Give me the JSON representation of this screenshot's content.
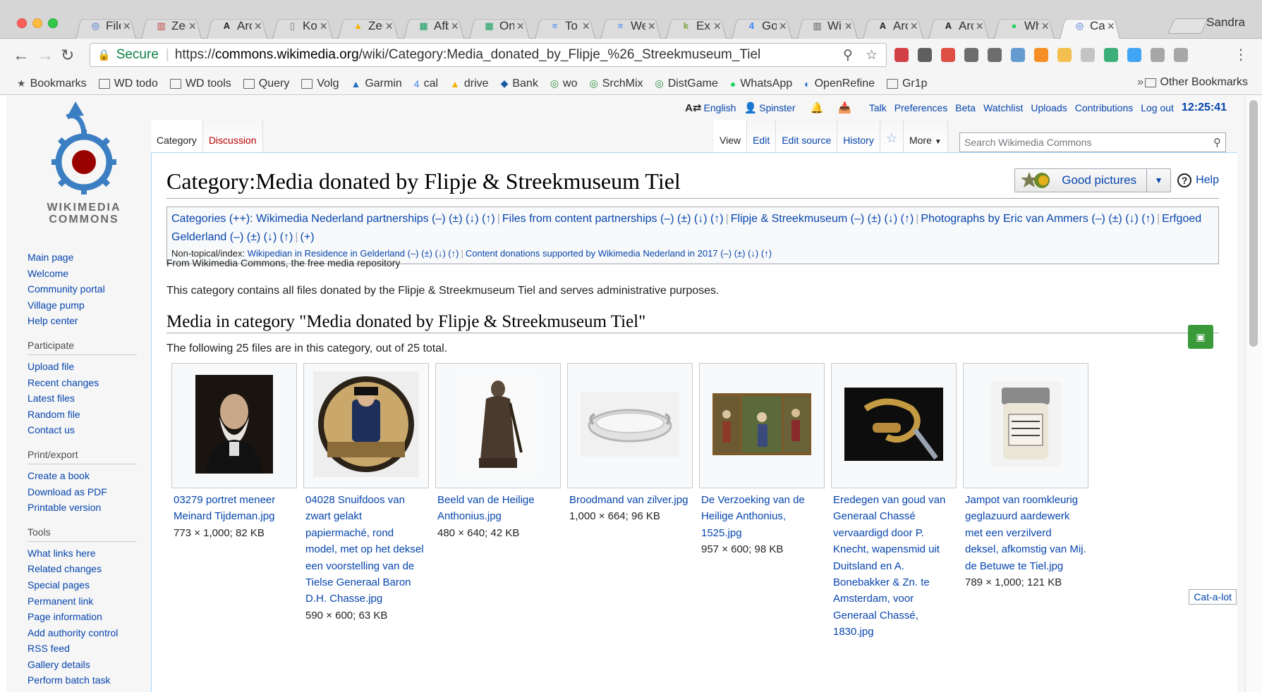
{
  "browser": {
    "profile_name": "Sandra",
    "tabs": [
      {
        "label": "File",
        "icon": "wikimedia-icon",
        "color": "#3366cc"
      },
      {
        "label": "Zee",
        "icon": "barcode-icon",
        "color": "#c43c3c"
      },
      {
        "label": "Arc",
        "icon": "archiefbank-icon",
        "color": "#1c1c1c"
      },
      {
        "label": "Kor",
        "icon": "page-icon",
        "color": "#777777"
      },
      {
        "label": "Zee",
        "icon": "drive-icon",
        "color": "#f4b400"
      },
      {
        "label": "Afb",
        "icon": "sheets-icon",
        "color": "#0f9d58"
      },
      {
        "label": "Onc",
        "icon": "sheets-icon",
        "color": "#0f9d58"
      },
      {
        "label": "To",
        "icon": "docs-icon",
        "color": "#4285f4"
      },
      {
        "label": "We",
        "icon": "docs-icon",
        "color": "#4285f4"
      },
      {
        "label": "Exp",
        "icon": "kaggle-icon",
        "color": "#7aa33c"
      },
      {
        "label": "Goo",
        "icon": "calendar-icon",
        "color": "#4285f4"
      },
      {
        "label": "Wik",
        "icon": "barcode-icon",
        "color": "#555555"
      },
      {
        "label": "Arc",
        "icon": "archiefbank-icon",
        "color": "#1c1c1c"
      },
      {
        "label": "Arc",
        "icon": "archiefbank-icon",
        "color": "#1c1c1c"
      },
      {
        "label": "Wh",
        "icon": "whatsapp-icon",
        "color": "#25d366"
      },
      {
        "label": "Cat",
        "icon": "wikimedia-icon",
        "color": "#3366cc",
        "active": true
      }
    ],
    "url_secure_label": "Secure",
    "url_scheme": "https://",
    "url_domain": "commons.wikimedia.org",
    "url_path": "/wiki/Category:Media_donated_by_Flipje_%26_Streekmuseum_Tiel",
    "extensions": [
      {
        "icon": "pinterest-icon",
        "color": "#cb2027"
      },
      {
        "icon": "evernote-icon",
        "color": "#444444"
      },
      {
        "icon": "calendar-badge-icon",
        "color": "#d93025"
      },
      {
        "icon": "reader-icon",
        "color": "#555555"
      },
      {
        "icon": "globe-icon",
        "color": "#555555"
      },
      {
        "icon": "screenshot-icon",
        "color": "#4a8cca"
      },
      {
        "icon": "chart-icon",
        "color": "#f57c00"
      },
      {
        "icon": "folder-icon",
        "color": "#f2b632"
      },
      {
        "icon": "cloud-icon",
        "color": "#bbbbbb"
      },
      {
        "icon": "leaf-icon",
        "color": "#1aa260"
      },
      {
        "icon": "download-icon",
        "color": "#2196f3"
      },
      {
        "icon": "tab-icon",
        "color": "#999999"
      },
      {
        "icon": "window-icon",
        "color": "#999999"
      }
    ],
    "bookmarks": [
      {
        "label": "Bookmarks",
        "icon": "star-icon"
      },
      {
        "label": "WD todo",
        "icon": "folder-icon"
      },
      {
        "label": "WD tools",
        "icon": "folder-icon"
      },
      {
        "label": "Query",
        "icon": "folder-icon"
      },
      {
        "label": "Volg",
        "icon": "folder-icon"
      },
      {
        "label": "Garmin",
        "icon": "garmin-icon"
      },
      {
        "label": "cal",
        "icon": "calendar-icon"
      },
      {
        "label": "drive",
        "icon": "drive-icon"
      },
      {
        "label": "Bank",
        "icon": "bank-icon"
      },
      {
        "label": "wo",
        "icon": "wikidata-icon"
      },
      {
        "label": "SrchMix",
        "icon": "wikidata-icon"
      },
      {
        "label": "DistGame",
        "icon": "wikidata-icon"
      },
      {
        "label": "WhatsApp",
        "icon": "whatsapp-icon"
      },
      {
        "label": "OpenRefine",
        "icon": "openrefine-icon"
      },
      {
        "label": "Gr1p",
        "icon": "folder-icon"
      }
    ],
    "bookmarks_overflow": "»",
    "other_bookmarks": "Other Bookmarks"
  },
  "wiki": {
    "logo_line1": "WIKIMEDIA",
    "logo_line2": "COMMONS",
    "personal": {
      "language": "English",
      "username": "Spinster",
      "links": [
        "Talk",
        "Preferences",
        "Beta",
        "Watchlist",
        "Uploads",
        "Contributions",
        "Log out"
      ],
      "clock": "12:25:41"
    },
    "nav_tabs_left": [
      {
        "label": "Category",
        "selected": true
      },
      {
        "label": "Discussion",
        "selected": false
      }
    ],
    "nav_tabs_right": [
      {
        "label": "View",
        "selected": true
      },
      {
        "label": "Edit"
      },
      {
        "label": "Edit source"
      },
      {
        "label": "History"
      },
      {
        "label": "☆"
      },
      {
        "label": "More"
      }
    ],
    "search_placeholder": "Search Wikimedia Commons",
    "sidebar": {
      "main": [
        "Main page",
        "Welcome",
        "Community portal",
        "Village pump",
        "Help center"
      ],
      "participate_heading": "Participate",
      "participate": [
        "Upload file",
        "Recent changes",
        "Latest files",
        "Random file",
        "Contact us"
      ],
      "print_heading": "Print/export",
      "print": [
        "Create a book",
        "Download as PDF",
        "Printable version"
      ],
      "tools_heading": "Tools",
      "tools": [
        "What links here",
        "Related changes",
        "Special pages",
        "Permanent link",
        "Page information",
        "Add authority control",
        "RSS feed",
        "Gallery details",
        "Perform batch task"
      ]
    },
    "page_title": "Category:Media donated by Flipje & Streekmuseum Tiel",
    "indicator_goodpictures": "Good pictures",
    "indicator_help": "Help",
    "catlinks": {
      "prefix": "Categories (++):",
      "items": [
        {
          "name": "Wikimedia Nederland partnerships",
          "tools": "(–) (±) (↓) (↑)"
        },
        {
          "name": "Files from content partnerships",
          "tools": "(–) (±) (↓) (↑)"
        },
        {
          "name": "Flipje & Streekmuseum",
          "tools": "(–) (±) (↓) (↑)"
        },
        {
          "name": "Photographs by Eric van Ammers",
          "tools": "(–) (±) (↓) (↑)"
        },
        {
          "name": "Erfgoed Gelderland",
          "tools": "(–) (±) (↓) (↑)"
        }
      ],
      "add": "(+)",
      "nontopical_prefix": "Non-topical/index:",
      "nontopical": [
        {
          "name": "Wikipedian in Residence in Gelderland",
          "tools": "(–) (±) (↓) (↑)"
        },
        {
          "name": "Content donations supported by Wikimedia Nederland in 2017",
          "tools": "(–) (±) (↓) (↑)"
        }
      ]
    },
    "from_line": "From Wikimedia Commons, the free media repository",
    "description": "This category contains all files donated by the Flipje & Streekmuseum Tiel and serves administrative purposes.",
    "media_heading": "Media in category \"Media donated by Flipje & Streekmuseum Tiel\"",
    "count_line": "The following 25 files are in this category, out of 25 total.",
    "gallery": [
      {
        "name": "03279 portret meneer Meinard Tijdeman.jpg",
        "meta": "773 × 1,000; 82 KB",
        "thumb": "portrait"
      },
      {
        "name": "04028 Snuifdoos van zwart gelakt papiermaché, rond model, met op het deksel een voorstelling van de Tielse Generaal Baron D.H. Chasse.jpg",
        "meta": "590 × 600; 63 KB",
        "thumb": "snuffbox"
      },
      {
        "name": "Beeld van de Heilige Anthonius.jpg",
        "meta": "480 × 640; 42 KB",
        "thumb": "statue"
      },
      {
        "name": "Broodmand van zilver.jpg",
        "meta": "1,000 × 664; 96 KB",
        "thumb": "basket"
      },
      {
        "name": "De Verzoeking van de Heilige Anthonius, 1525.jpg",
        "meta": "957 × 600; 98 KB",
        "thumb": "triptych"
      },
      {
        "name": "Eredegen van goud van Generaal Chassé vervaardigd door P. Knecht, wapensmid uit Duitsland en A. Bonebakker & Zn. te Amsterdam, voor Generaal Chassé, 1830.jpg",
        "meta": "",
        "thumb": "sword"
      },
      {
        "name": "Jampot van roomkleurig geglazuurd aardewerk met een verzilverd deksel, afkomstig van Mij. de Betuwe te Tiel.jpg",
        "meta": "789 × 1,000; 121 KB",
        "thumb": "jampot"
      }
    ],
    "catalot": "Cat-a-lot",
    "colors": {
      "link": "#0645ad",
      "redlink": "#ba0000",
      "border": "#a7d7f9"
    }
  }
}
